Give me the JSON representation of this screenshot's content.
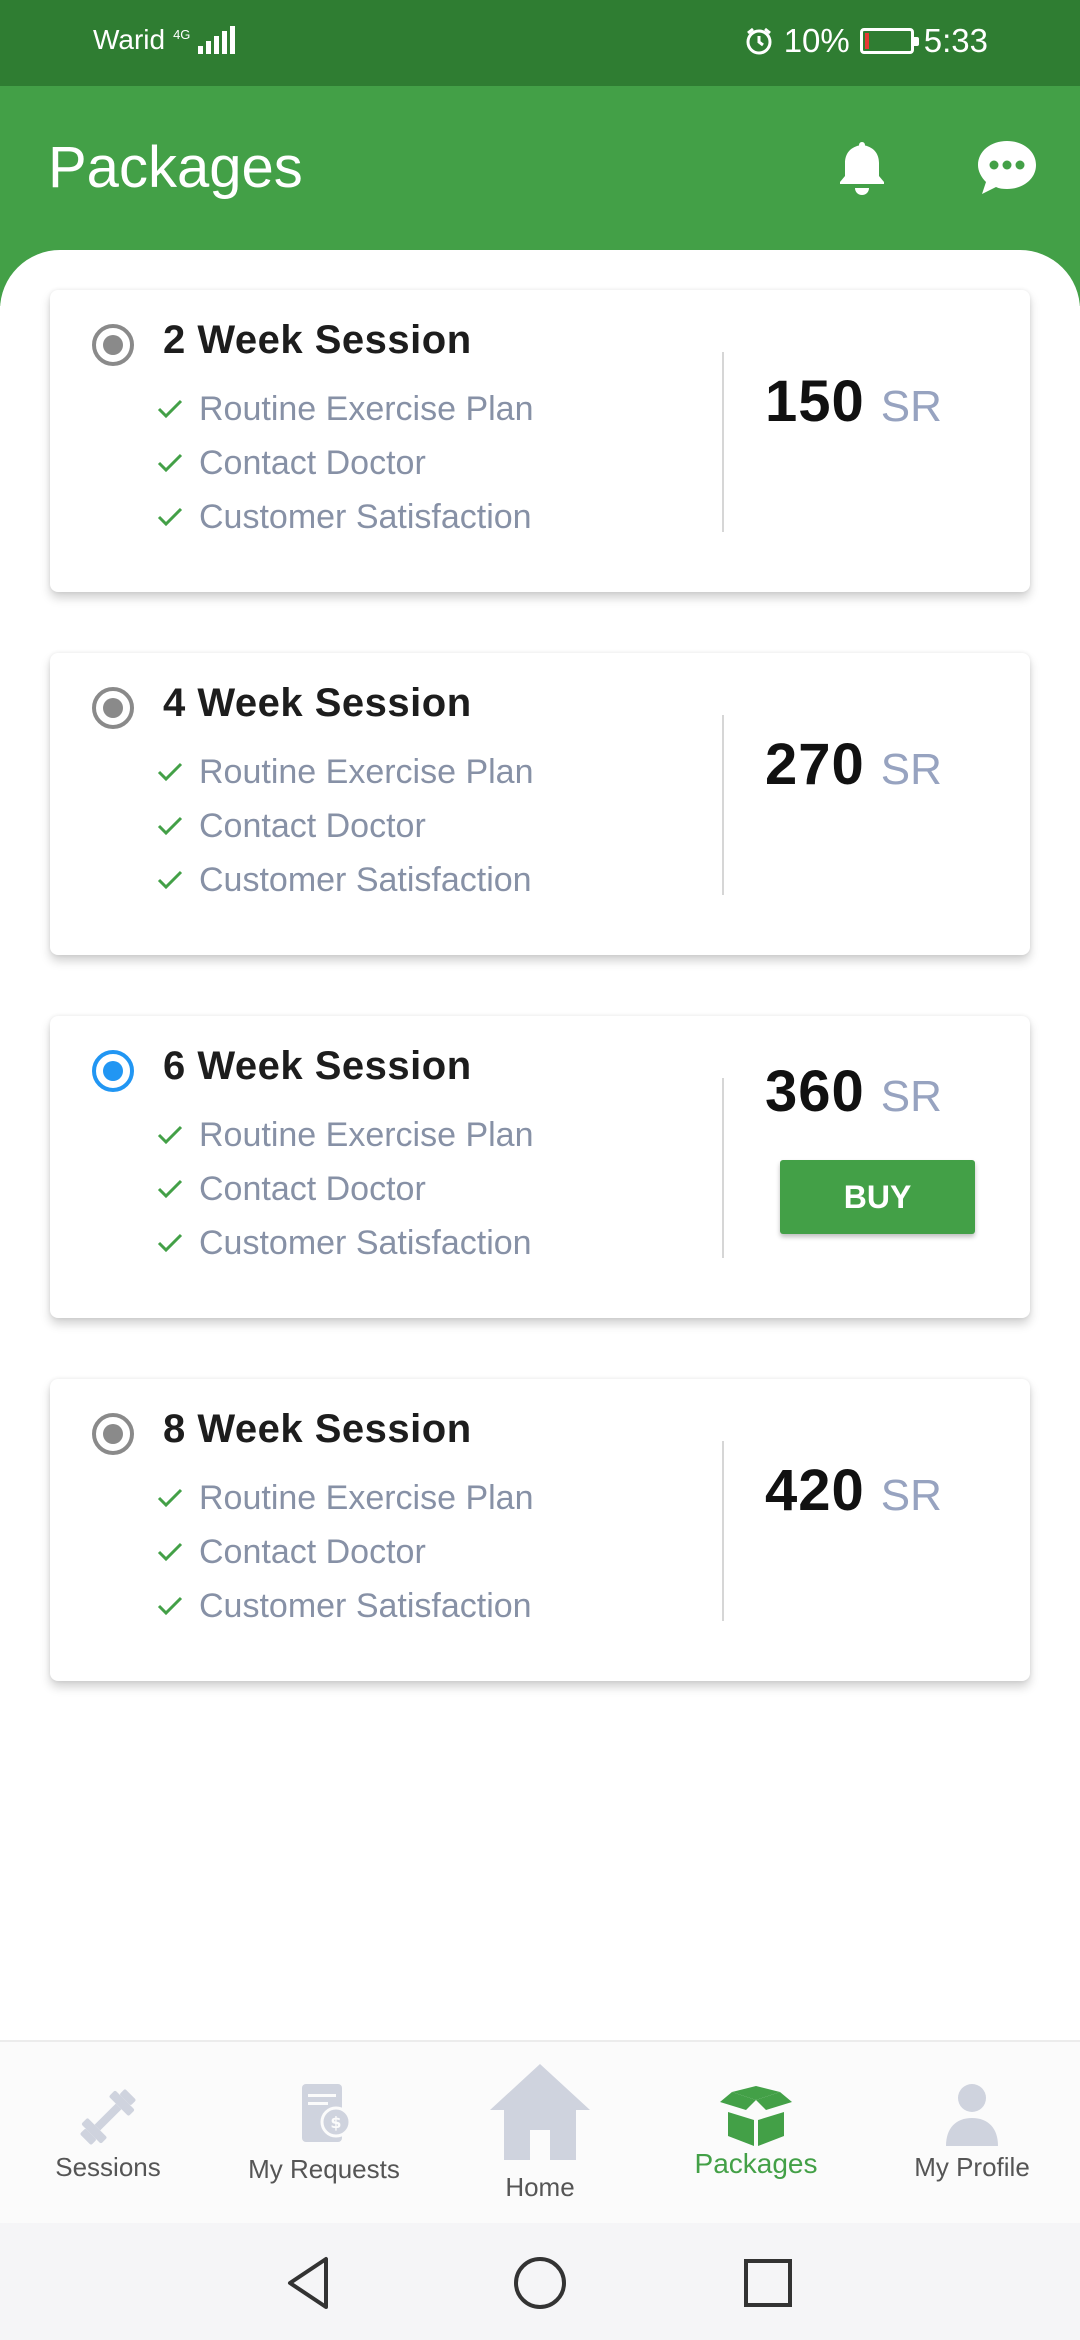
{
  "status_bar": {
    "carrier": "Warid",
    "network": "4G",
    "battery": "10%",
    "battery_level": 0.1,
    "time": "5:33"
  },
  "header": {
    "title": "Packages",
    "icons": [
      "bell-icon",
      "chat-icon"
    ]
  },
  "packages": [
    {
      "title": "2 Week Session",
      "features": [
        "Routine Exercise Plan",
        "Contact Doctor",
        "Customer Satisfaction"
      ],
      "price": "150",
      "currency": "SR",
      "selected": false
    },
    {
      "title": "4 Week Session",
      "features": [
        "Routine Exercise Plan",
        "Contact Doctor",
        "Customer Satisfaction"
      ],
      "price": "270",
      "currency": "SR",
      "selected": false
    },
    {
      "title": "6 Week Session",
      "features": [
        "Routine Exercise Plan",
        "Contact Doctor",
        "Customer Satisfaction"
      ],
      "price": "360",
      "currency": "SR",
      "selected": true,
      "buy_label": "BUY"
    },
    {
      "title": "8 Week Session",
      "features": [
        "Routine Exercise Plan",
        "Contact Doctor",
        "Customer Satisfaction"
      ],
      "price": "420",
      "currency": "SR",
      "selected": false
    }
  ],
  "bottom_nav": {
    "items": [
      {
        "label": "Sessions",
        "icon": "dumbbell-icon"
      },
      {
        "label": "My Requests",
        "icon": "requests-icon"
      },
      {
        "label": "Home",
        "icon": "home-icon"
      },
      {
        "label": "Packages",
        "icon": "packages-icon",
        "active": true
      },
      {
        "label": "My Profile",
        "icon": "profile-icon"
      }
    ]
  },
  "colors": {
    "primary": "#43a047",
    "status_bar": "#2f7d32",
    "selected_radio": "#2196f3",
    "inactive_icon": "#cfd3de"
  }
}
